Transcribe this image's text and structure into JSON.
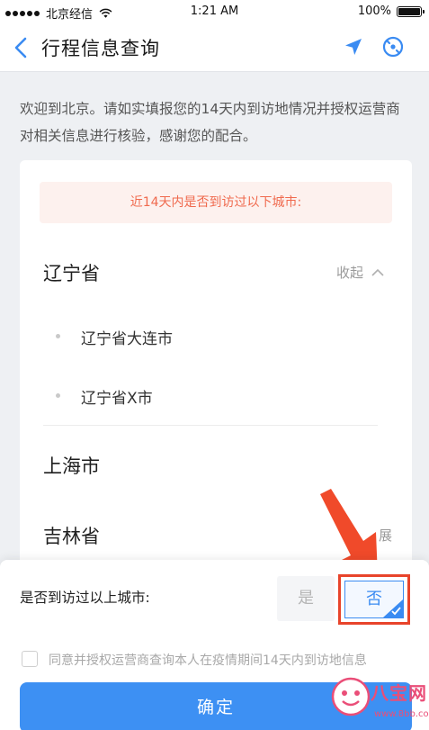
{
  "status_bar": {
    "carrier": "北京经信",
    "time": "1:21 AM",
    "battery": "100%",
    "battery_level": 1.0
  },
  "nav": {
    "title": "行程信息查询"
  },
  "intro": "欢迎到北京。请如实填报您的14天内到访地情况并授权运营商对相关信息进行核验，感谢您的配合。",
  "card": {
    "notice": "近14天内是否到访过以下城市:",
    "provinces": [
      {
        "name": "辽宁省",
        "toggle": "收起",
        "cities": [
          "辽宁省大连市",
          "辽宁省X市"
        ]
      },
      {
        "name": "上海市"
      },
      {
        "name": "吉林省",
        "toggle": "展"
      }
    ]
  },
  "answer": {
    "question": "是否到访过以上城市:",
    "yes_label": "是",
    "no_label": "否",
    "selected": "no"
  },
  "consent": {
    "text": "同意并授权运营商查询本人在疫情期间14天内到访地信息"
  },
  "confirm": {
    "label": "确定"
  },
  "watermark": {
    "name": "八宝网",
    "url": "www.8bb.com"
  },
  "colors": {
    "accent": "#3d90f3",
    "notice_text": "#f06a4e",
    "highlight": "#e8442b"
  }
}
